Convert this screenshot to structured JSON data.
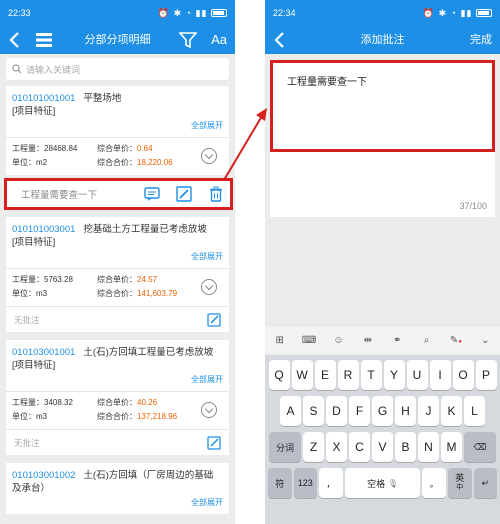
{
  "left": {
    "status_time": "22:33",
    "title": "分部分项明细",
    "aa_label": "Aa",
    "search_placeholder": "请输入关键词",
    "items": [
      {
        "code": "010101001001",
        "name": "平整场地",
        "sub": "[项目特征]",
        "expand": "全部展开",
        "qty_label": "工程量：28468.84",
        "unit_label": "单位：m2",
        "price_label": "综合单价：",
        "price": "0.64",
        "total_label": "综合合价：",
        "total": "18,220.06"
      },
      {
        "code": "010101003001",
        "name": "挖基础土方工程量已考虑放坡",
        "sub": "[项目特征]",
        "expand": "全部展开",
        "qty_label": "工程量：5763.28",
        "unit_label": "单位：m3",
        "price_label": "综合单价：",
        "price": "24.57",
        "total_label": "综合合价：",
        "total": "141,603.79",
        "note": "无批注"
      },
      {
        "code": "010103001001",
        "name": "土(石)方回填工程量已考虑放坡",
        "sub": "[项目特征]",
        "expand": "全部展开",
        "qty_label": "工程量：3408.32",
        "unit_label": "单位：m3",
        "price_label": "综合单价：",
        "price": "40.26",
        "total_label": "综合合价：",
        "total": "137,218.96",
        "note": "无批注"
      },
      {
        "code": "010103001002",
        "name": "土(石)方回填（厂房周边的基础",
        "sub": "及承台）",
        "expand": "全部展开"
      }
    ],
    "annotation_text": "工程量需要查一下"
  },
  "right": {
    "status_time": "22:34",
    "title": "添加批注",
    "done_label": "完成",
    "input_text": "工程量需要查一下",
    "counter": "37/100",
    "keyboard": {
      "row1": [
        "Q",
        "W",
        "E",
        "R",
        "T",
        "Y",
        "U",
        "I",
        "O",
        "P"
      ],
      "row2": [
        "A",
        "S",
        "D",
        "F",
        "G",
        "H",
        "J",
        "K",
        "L"
      ],
      "row3": [
        "Z",
        "X",
        "C",
        "V",
        "B",
        "N",
        "M"
      ],
      "shift_label": "分词",
      "symbol_label": "符",
      "num_label": "123",
      "comma_label": "，",
      "space_label": "空格",
      "period_label": "。",
      "lang_label": "英",
      "lang_sub": "中"
    }
  },
  "colors": {
    "accent": "#1e8fe6",
    "highlight": "#d4201f",
    "price": "#f06000"
  }
}
